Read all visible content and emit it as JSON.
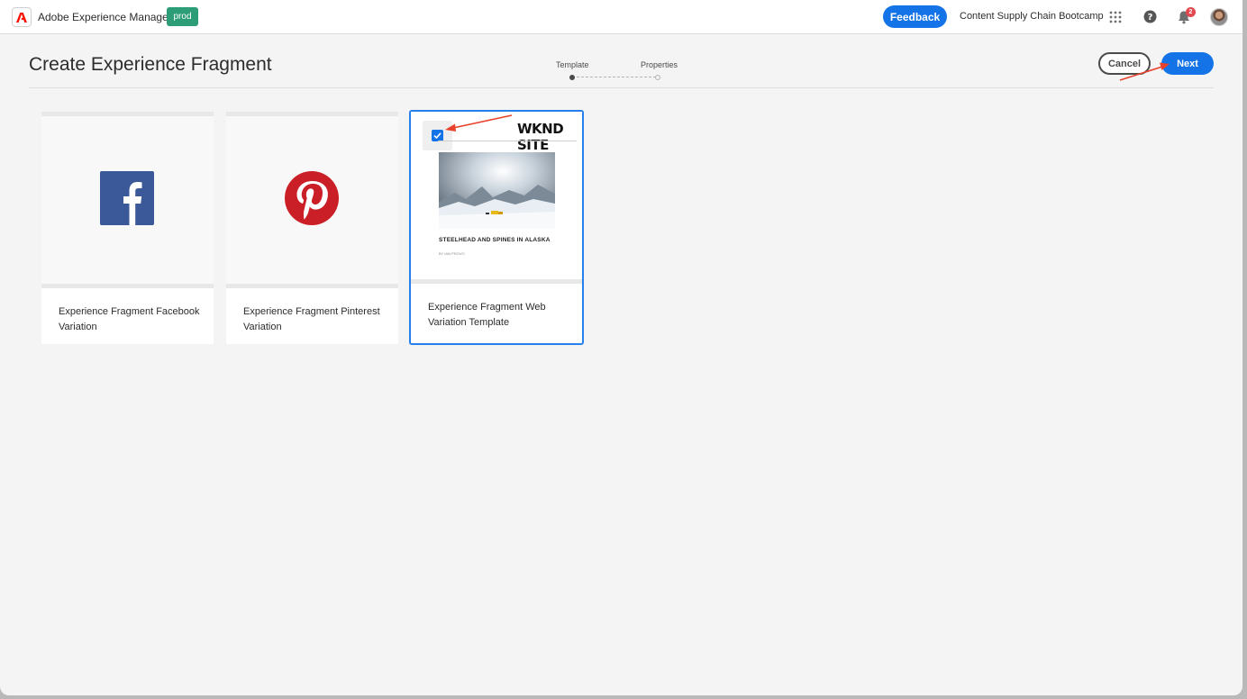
{
  "topbar": {
    "app_name": "Adobe Experience Manager",
    "env_badge": "prod",
    "feedback_label": "Feedback",
    "org_name": "Content Supply Chain Bootcamp",
    "notification_count": "2"
  },
  "header": {
    "title": "Create Experience Fragment",
    "steps": [
      {
        "label": "Template",
        "active": true
      },
      {
        "label": "Properties",
        "active": false
      }
    ],
    "cancel_label": "Cancel",
    "next_label": "Next"
  },
  "templates": [
    {
      "title": "Experience Fragment Facebook Variation",
      "icon": "facebook-logo-icon",
      "selected": false
    },
    {
      "title": "Experience Fragment Pinterest Variation",
      "icon": "pinterest-logo-icon",
      "selected": false
    },
    {
      "title": "Experience Fragment Web Variation Template",
      "selected": true,
      "preview": {
        "brand": "WKND SITE",
        "headline": "STEELHEAD AND SPINES IN ALASKA",
        "byline": "BY IAN PROVO"
      }
    }
  ],
  "colors": {
    "accent": "#1473e6",
    "selection_border": "#2680eb",
    "env_badge": "#2d9d78",
    "annotation_arrow": "#e8412c"
  }
}
